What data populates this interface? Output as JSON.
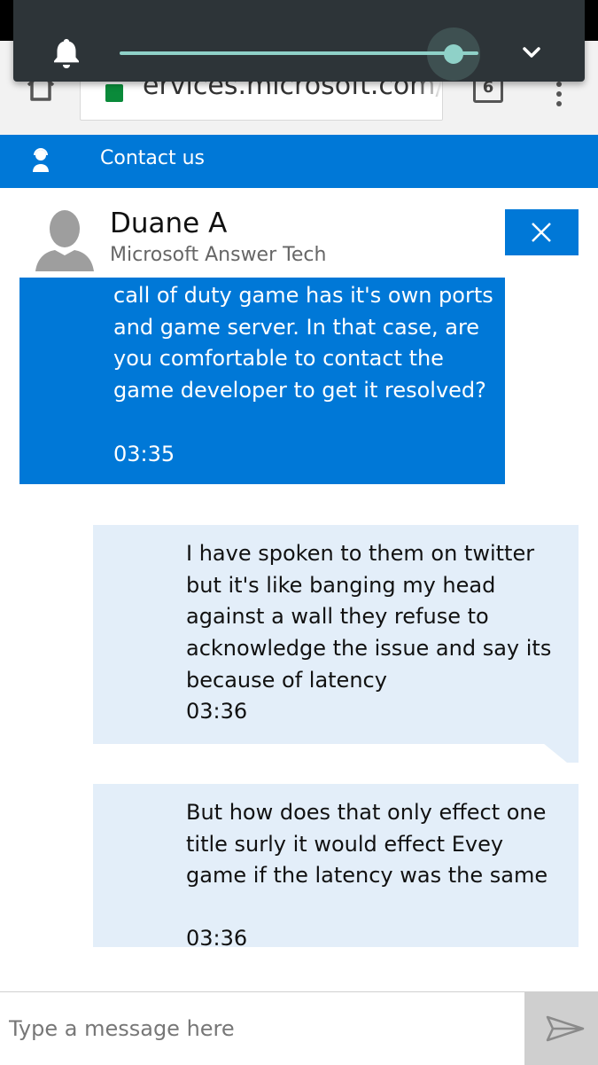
{
  "browser": {
    "url": "ervices.microsoft.com/",
    "tab_count": "6"
  },
  "header": {
    "title": "Contact us"
  },
  "agent": {
    "name": "Duane A",
    "role": "Microsoft Answer Tech"
  },
  "messages": [
    {
      "sender": "agent",
      "text": "call of duty game has it's own ports and game server. In that case, are you comfortable to contact the game developer to get it resolved?",
      "time": "03:35"
    },
    {
      "sender": "user",
      "text": "I have spoken to them on twitter but it's like banging my head against a wall they refuse to acknowledge the issue and say its because of latency",
      "time": "03:36"
    },
    {
      "sender": "user",
      "text": "But how does that only effect one title surly it would effect Evey game if the latency was the same",
      "time": "03:36"
    }
  ],
  "composer": {
    "placeholder": "Type a message here"
  },
  "volume": {
    "level": 0.93
  },
  "colors": {
    "accent": "#0078d7",
    "user_bubble": "#e3eef9",
    "volume_accent": "#8fd1c8"
  },
  "icons": [
    "bell-icon",
    "chevron-down-icon",
    "home-icon",
    "lock-icon",
    "tabs-icon",
    "more-icon",
    "agent-icon",
    "avatar-icon",
    "close-icon",
    "send-icon"
  ]
}
